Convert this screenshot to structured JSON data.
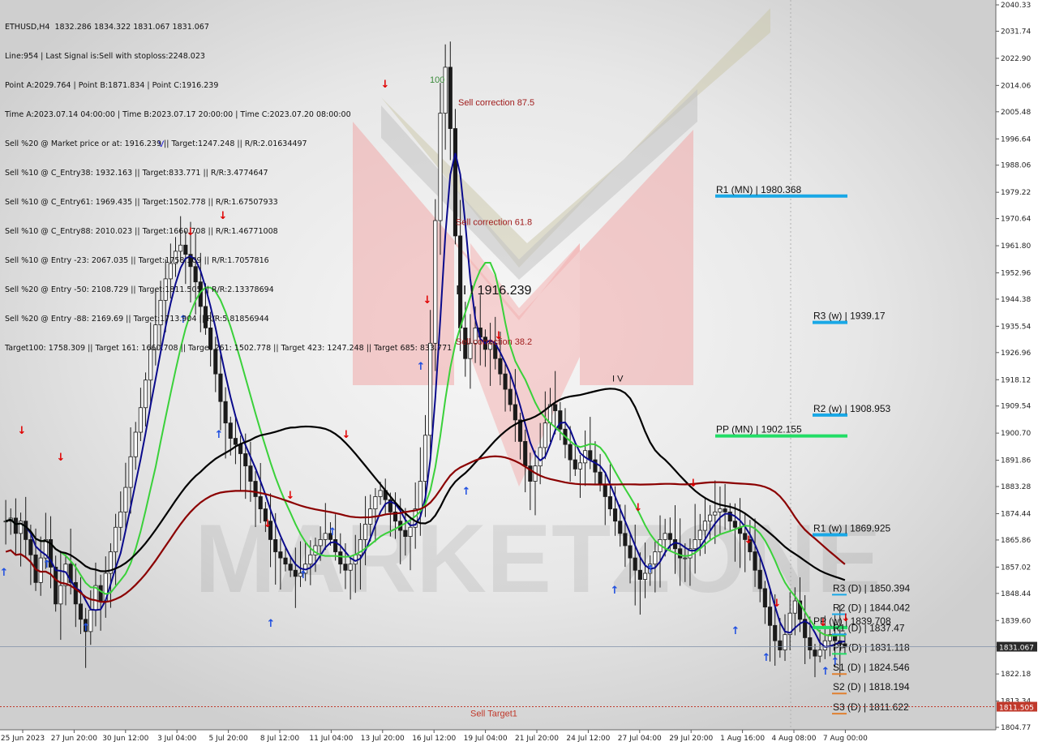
{
  "header": {
    "symbol": "ETHUSD,H4",
    "ohlc": "1832.286 1834.322 1831.067 1831.067",
    "lines": [
      "Line:954 | Last Signal is:Sell with stoploss:2248.023",
      "Point A:2029.764 | Point B:1871.834 | Point C:1916.239",
      "Time A:2023.07.14 04:00:00 | Time B:2023.07.17 20:00:00 | Time C:2023.07.20 08:00:00",
      "Sell %20 @ Market price or at: 1916.239 || Target:1247.248 || R/R:2.01634497",
      "Sell %10 @ C_Entry38: 1932.163 || Target:833.771 || R/R:3.4774647",
      "Sell %10 @ C_Entry61: 1969.435 || Target:1502.778 || R/R:1.67507933",
      "Sell %10 @ C_Entry88: 2010.023 || Target:1660.708 || R/R:1.46771008",
      "Sell %10 @ Entry -23: 2067.035 || Target:1758.309 || R/R:1.7057816",
      "Sell %20 @ Entry -50: 2108.729 || Target:1811.505 || R/R:2.13378694",
      "Sell %20 @ Entry -88: 2169.69 || Target:1713.904 || R/R:5.81856944",
      "Target100: 1758.309 || Target 161: 1660.708 || Target 261: 1502.778 || Target 423: 1247.248 || Target 685: 833.771"
    ]
  },
  "chart_data": {
    "type": "candlestick",
    "symbol": "ETHUSD",
    "timeframe": "H4",
    "y_range": [
      1804.77,
      2040.33
    ],
    "y_ticks": [
      2040.33,
      2031.74,
      2022.9,
      2014.06,
      2005.48,
      1996.64,
      1988.06,
      1979.22,
      1970.64,
      1961.8,
      1952.96,
      1944.38,
      1935.54,
      1926.96,
      1918.12,
      1909.54,
      1900.7,
      1891.86,
      1883.28,
      1874.44,
      1865.86,
      1857.02,
      1848.44,
      1839.6,
      1831.02,
      1822.18,
      1813.34,
      1804.77
    ],
    "x_tick_labels": [
      "25 Jun 2023",
      "27 Jun 20:00",
      "30 Jun 12:00",
      "3 Jul 04:00",
      "5 Jul 20:00",
      "8 Jul 12:00",
      "11 Jul 04:00",
      "13 Jul 20:00",
      "16 Jul 12:00",
      "19 Jul 04:00",
      "21 Jul 20:00",
      "24 Jul 12:00",
      "27 Jul 04:00",
      "29 Jul 20:00",
      "1 Aug 16:00",
      "4 Aug 08:00",
      "7 Aug 00:00"
    ],
    "current_price": 1831.067,
    "current_price_label": "1831.067",
    "target_price": 1811.505,
    "target_label": "1811.505",
    "sell_target_label": "Sell Target1",
    "levels": [
      {
        "label": "R1 (MN) | 1980.368",
        "price": 1980.368,
        "color": "#19a8e6"
      },
      {
        "label": "R3 (w) | 1939.17",
        "price": 1939.17,
        "color": "#19a8e6"
      },
      {
        "label": "R2 (w) | 1908.953",
        "price": 1908.953,
        "color": "#19a8e6"
      },
      {
        "label": "PP (MN) | 1902.155",
        "price": 1902.155,
        "color": "#22dd66"
      },
      {
        "label": "R1 (w) | 1869.925",
        "price": 1869.925,
        "color": "#19a8e6"
      },
      {
        "label": "R3 (D) | 1850.394",
        "price": 1850.394,
        "color": "#19a8e6"
      },
      {
        "label": "R2 (D) | 1844.042",
        "price": 1844.042,
        "color": "#19a8e6"
      },
      {
        "label": "PP (w) | 1839.708",
        "price": 1839.708,
        "color": "#22dd66"
      },
      {
        "label": "R1 (D) | 1837.47",
        "price": 1837.47,
        "color": "#19a8e6"
      },
      {
        "label": "PP (D) | 1831.118",
        "price": 1831.118,
        "color": "#22dd66"
      },
      {
        "label": "S1 (D) | 1824.546",
        "price": 1824.546,
        "color": "#e08030"
      },
      {
        "label": "S2 (D) | 1818.194",
        "price": 1818.194,
        "color": "#e08030"
      },
      {
        "label": "S3 (D) | 1811.622",
        "price": 1811.622,
        "color": "#e08030"
      }
    ],
    "annotations": [
      {
        "text": "Sell correction 87.5",
        "price": 2007.5
      },
      {
        "text": "Sell correction 61.8",
        "price": 1968.5
      },
      {
        "text": "Sell correction 38.2",
        "price": 1929.5
      },
      {
        "text": "100",
        "price": 2015.0
      },
      {
        "text": "V",
        "price": 1994.0
      },
      {
        "text": "I I I 1916.239",
        "price": 1946.0
      },
      {
        "text": "I V",
        "price": 1917.5
      }
    ],
    "close_series": [
      1872,
      1873,
      1868,
      1872,
      1866,
      1861,
      1852,
      1860,
      1866,
      1857,
      1845,
      1851,
      1858,
      1852,
      1845,
      1840,
      1836,
      1843,
      1851,
      1846,
      1855,
      1862,
      1870,
      1875,
      1883,
      1893,
      1901,
      1909,
      1918,
      1928,
      1936,
      1944,
      1951,
      1956,
      1960,
      1962,
      1959,
      1955,
      1950,
      1942,
      1935,
      1928,
      1920,
      1911,
      1904,
      1899,
      1897,
      1894,
      1890,
      1885,
      1880,
      1876,
      1872,
      1866,
      1862,
      1860,
      1858,
      1856,
      1854,
      1855,
      1858,
      1861,
      1864,
      1866,
      1868,
      1866,
      1862,
      1858,
      1856,
      1858,
      1861,
      1866,
      1871,
      1876,
      1880,
      1882,
      1879,
      1875,
      1872,
      1869,
      1867,
      1870,
      1876,
      1885,
      1900,
      1930,
      1970,
      2005,
      2020,
      2000,
      1965,
      1935,
      1925,
      1930,
      1935,
      1932,
      1928,
      1930,
      1925,
      1920,
      1915,
      1910,
      1905,
      1898,
      1890,
      1885,
      1890,
      1896,
      1904,
      1910,
      1908,
      1902,
      1897,
      1892,
      1889,
      1891,
      1895,
      1892,
      1888,
      1884,
      1880,
      1876,
      1872,
      1868,
      1864,
      1860,
      1856,
      1853,
      1855,
      1858,
      1862,
      1866,
      1868,
      1866,
      1863,
      1860,
      1860,
      1863,
      1866,
      1869,
      1872,
      1874,
      1875,
      1876,
      1875,
      1872,
      1870,
      1868,
      1866,
      1862,
      1856,
      1850,
      1844,
      1838,
      1833,
      1830,
      1835,
      1842,
      1846,
      1840,
      1834,
      1830,
      1828,
      1830,
      1833,
      1835,
      1833,
      1832,
      1831
    ]
  }
}
